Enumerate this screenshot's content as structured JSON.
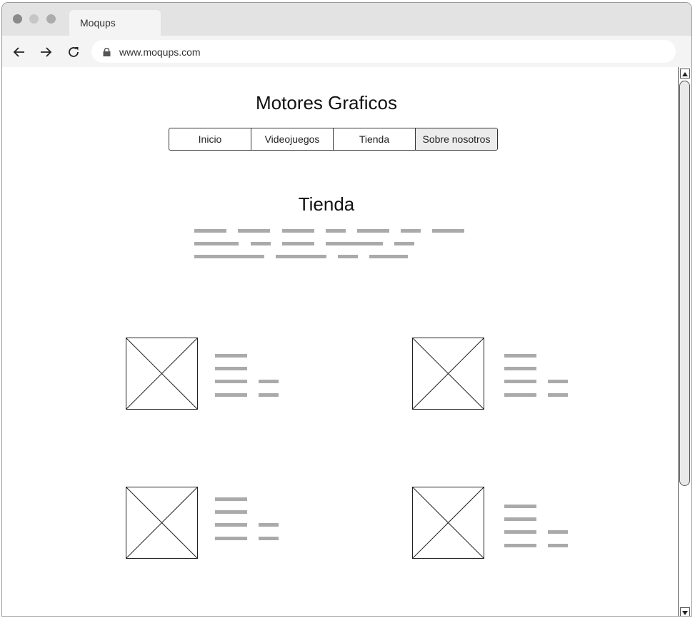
{
  "browser": {
    "tab_title": "Moqups",
    "url": "www.moqups.com",
    "icons": [
      "back-arrow-icon",
      "forward-arrow-icon",
      "reload-icon",
      "lock-icon"
    ]
  },
  "page": {
    "site_title": "Motores Graficos",
    "nav_items": [
      "Inicio",
      "Videojuegos",
      "Tienda",
      "Sobre nosotros"
    ],
    "section_title": "Tienda"
  },
  "colors": {
    "titlebar": "#e3e3e3",
    "toolbar": "#f4f4f4",
    "placeholder_text": "#aaaaaa",
    "border": "#333333"
  }
}
